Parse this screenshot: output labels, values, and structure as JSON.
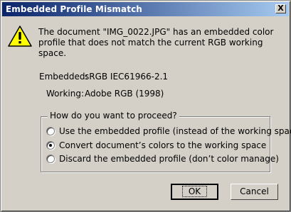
{
  "window": {
    "title": "Embedded Profile Mismatch",
    "close_glyph": "X"
  },
  "message": "The document \"IMG_0022.JPG\" has an embedded color profile that does not match the current RGB working space.",
  "profiles": {
    "embedded_label": "Embedded:",
    "embedded_value": "sRGB IEC61966-2.1",
    "working_label": "Working:",
    "working_value": "Adobe RGB (1998)"
  },
  "options": {
    "group_title": "How do you want to proceed?",
    "items": [
      {
        "label": "Use the embedded profile (instead of the working space)",
        "selected": false
      },
      {
        "label": "Convert document’s colors to the working space",
        "selected": true
      },
      {
        "label": "Discard the embedded profile (don’t color manage)",
        "selected": false
      }
    ]
  },
  "buttons": {
    "ok": "OK",
    "cancel": "Cancel"
  },
  "icons": {
    "warning": "warning-icon"
  }
}
